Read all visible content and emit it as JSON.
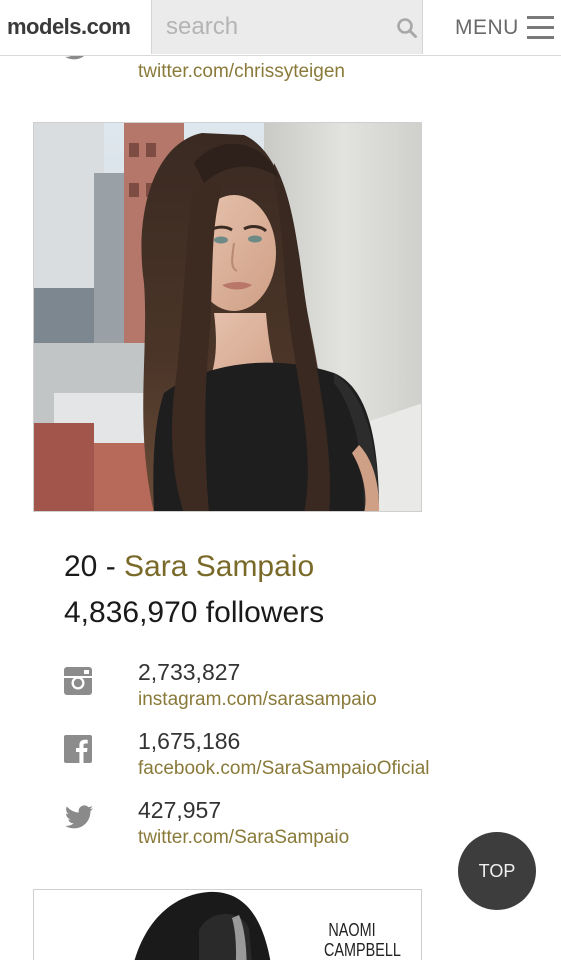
{
  "header": {
    "logo_main": "models",
    "logo_suffix": ".com",
    "search_placeholder": "search",
    "menu_label": "MENU"
  },
  "previous_item": {
    "twitter_link": "twitter.com/chrissyteigen"
  },
  "current_item": {
    "rank": "20",
    "separator": " - ",
    "name": "Sara Sampaio",
    "followers_text": "4,836,970 followers",
    "socials": [
      {
        "network": "instagram",
        "icon": "instagram-icon",
        "count": "2,733,827",
        "link": "instagram.com/sarasampaio"
      },
      {
        "network": "facebook",
        "icon": "facebook-icon",
        "count": "1,675,186",
        "link": "facebook.com/SaraSampaioOficial"
      },
      {
        "network": "twitter",
        "icon": "twitter-icon",
        "count": "427,957",
        "link": "twitter.com/SaraSampaio"
      }
    ]
  },
  "next_item": {
    "caption_line1": "NAOMI",
    "caption_line2": "CAMPBELL"
  },
  "top_button_label": "TOP",
  "colors": {
    "link": "#8a7a3a",
    "name_accent": "#7a6a2a",
    "top_button_bg": "#3d3d3d",
    "search_bg": "#ebebeb"
  }
}
